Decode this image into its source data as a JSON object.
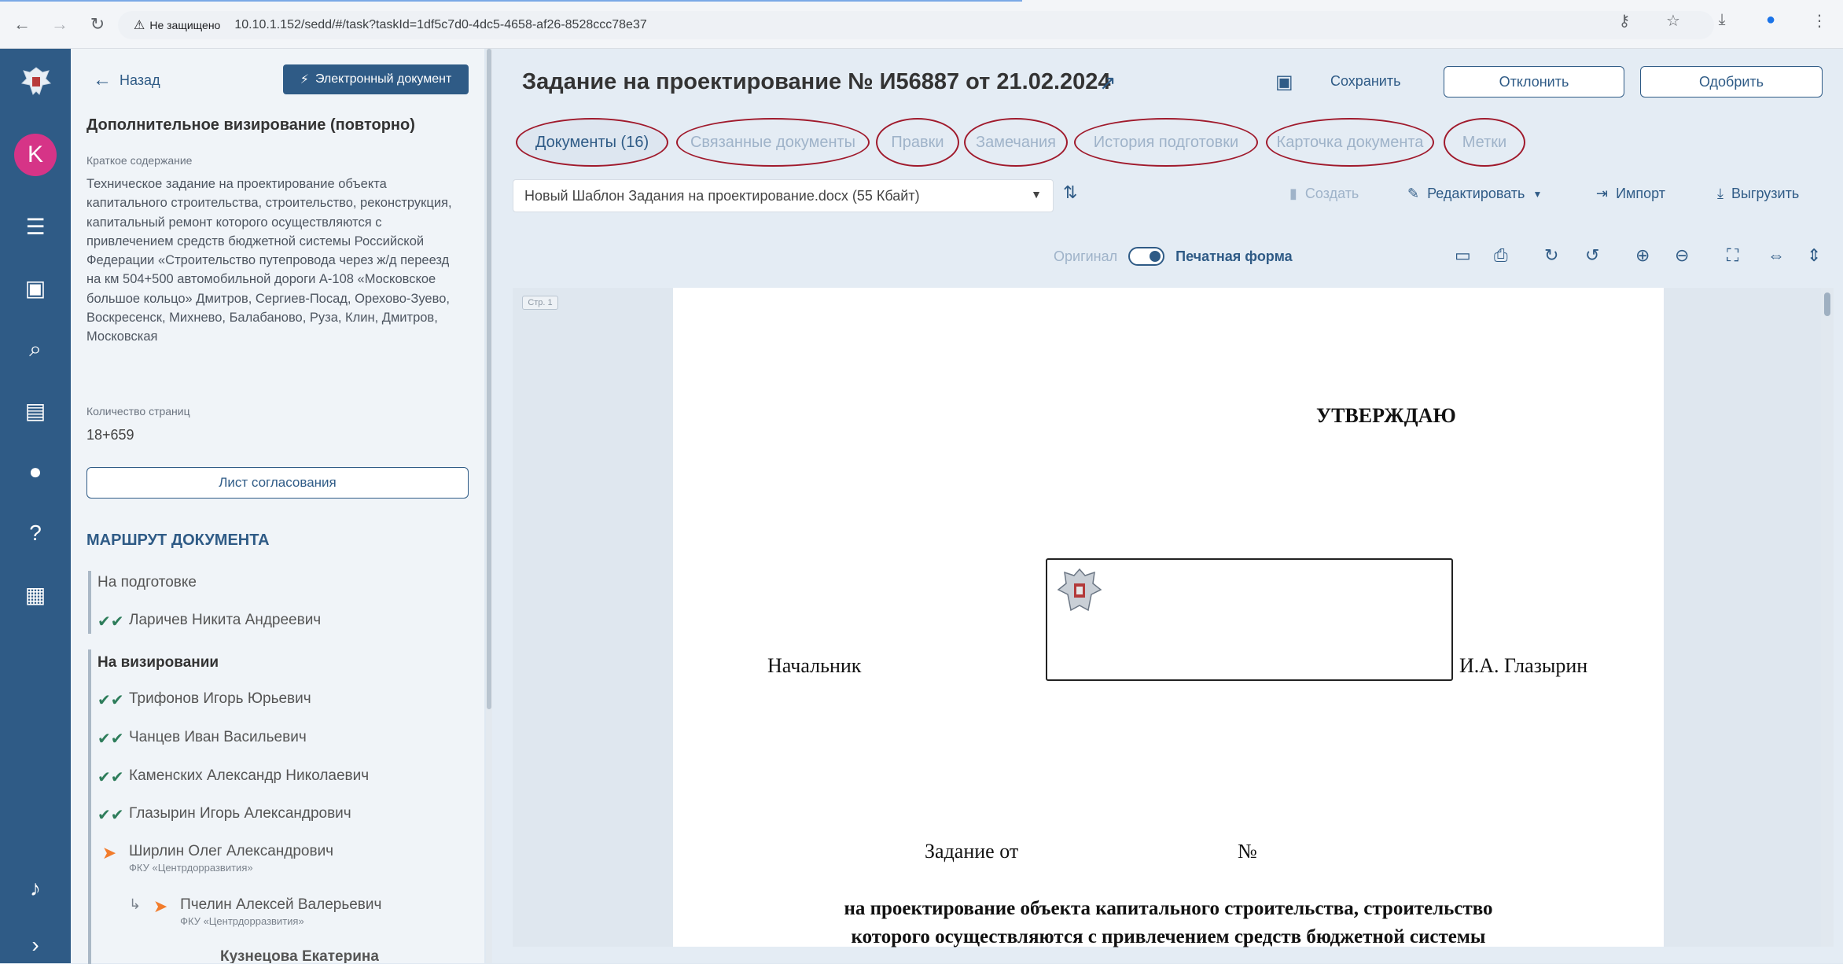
{
  "browser": {
    "security_label": "Не защищено",
    "url": "10.10.1.152/sedd/#/task?taskId=1df5c7d0-4dc5-4658-af26-8528ccc78e37"
  },
  "leftnav": {
    "avatar_letter": "K",
    "items": [
      "list-icon",
      "calendar-icon",
      "search-icon",
      "archive-icon",
      "person-icon",
      "help-icon",
      "calendar-add-icon",
      "bell-icon",
      "chevron-right-icon"
    ]
  },
  "sidebar": {
    "back_label": "Назад",
    "edoc_button": "Электронный документ",
    "title": "Дополнительное визирование (повторно)",
    "summary_label": "Краткое содержание",
    "summary_text": "Техническое задание на проектирование объекта капитального строительства, строительство, реконструкция, капитальный ремонт которого осуществляются с привлечением средств бюджетной системы Российской Федерации «Строительство путепровода через ж/д переезд на км 504+500 автомобильной дороги А-108 «Московское большое кольцо» Дмитров, Сергиев-Посад, Орехово-Зуево, Воскресенск, Михнево, Балабаново, Руза, Клин, Дмитров, Московская",
    "pages_label": "Количество страниц",
    "pages_value": "18+659",
    "approval_sheet_button": "Лист согласования",
    "route_title": "МАРШРУТ ДОКУМЕНТА",
    "stage1": "На подготовке",
    "stage1_person": "Ларичев Никита Андреевич",
    "stage2": "На визировании",
    "stage2_people": [
      "Трифонов Игорь Юрьевич",
      "Чанцев Иван Васильевич",
      "Каменских Александр Николаевич",
      "Глазырин Игорь Александрович"
    ],
    "current_person": "Ширлин Олег Александрович",
    "current_org": "ФКУ «Центрдорразвития»",
    "sub_person": "Пчелин Алексей Валерьевич",
    "sub_org": "ФКУ «Центрдорразвития»",
    "next_person_partial": "Кузнецова Екатерина"
  },
  "header": {
    "title": "Задание на проектирование № И56887 от 21.02.2024",
    "save_label": "Сохранить",
    "reject_label": "Отклонить",
    "approve_label": "Одобрить"
  },
  "tabs": [
    {
      "label": "Документы (16)"
    },
    {
      "label": "Связанные документы"
    },
    {
      "label": "Правки"
    },
    {
      "label": "Замечания"
    },
    {
      "label": "История подготовки"
    },
    {
      "label": "Карточка документа"
    },
    {
      "label": "Метки"
    }
  ],
  "toolbar": {
    "file_name": "Новый Шаблон Задания на проектирование.docx (55 Кбайт)",
    "create_label": "Создать",
    "edit_label": "Редактировать",
    "import_label": "Импорт",
    "export_label": "Выгрузить",
    "original_label": "Оригинал",
    "print_form_label": "Печатная форма"
  },
  "viewer": {
    "page_chip": "Стр. 1"
  },
  "document": {
    "approve_heading": "УТВЕРЖДАЮ",
    "position": "Начальник",
    "signer": "И.А. Глазырин",
    "task_from": "Задание от",
    "number_sign": "№",
    "line1": "на проектирование объекта капитального строительства, строительство",
    "line2": "которого осуществляются с привлечением средств бюджетной системы"
  },
  "colors": {
    "nav_bg": "#2f5b86",
    "accent": "#2f5b86",
    "tab_highlight": "#a01a2c",
    "avatar": "#d63487",
    "route_in_progress": "#f27c2c",
    "route_done": "#2e7d5b"
  }
}
